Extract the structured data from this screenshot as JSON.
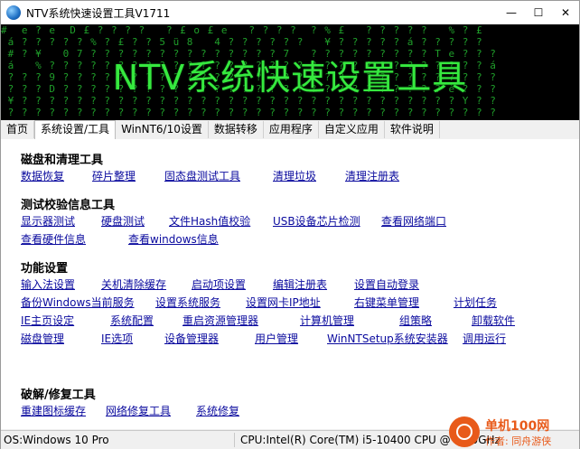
{
  "window": {
    "title": "NTV系统快速设置工具V1711",
    "controls": {
      "minimize": "—",
      "maximize": "☐",
      "close": "✕"
    }
  },
  "banner": {
    "title": "NTV系统快速设置工具",
    "matrix_color": "#1f9e2a",
    "title_color": "#36e93f"
  },
  "tabs": [
    {
      "label": "首页",
      "active": false
    },
    {
      "label": "系统设置/工具",
      "active": true
    },
    {
      "label": "WinNT6/10设置",
      "active": false
    },
    {
      "label": "数据转移",
      "active": false
    },
    {
      "label": "应用程序",
      "active": false
    },
    {
      "label": "自定义应用",
      "active": false
    },
    {
      "label": "软件说明",
      "active": false
    }
  ],
  "sections": {
    "disk": {
      "title": "磁盘和清理工具",
      "links": [
        "数据恢复",
        "碎片整理",
        "固态盘测试工具",
        "清理垃圾",
        "清理注册表"
      ]
    },
    "test": {
      "title": "测试校验信息工具",
      "row1": [
        "显示器测试",
        "硬盘测试",
        "文件Hash值校验",
        "USB设备芯片检测",
        "查看网络端口"
      ],
      "row2": [
        "查看硬件信息",
        "查看windows信息"
      ]
    },
    "function": {
      "title": "功能设置",
      "row1": [
        "输入法设置",
        "关机清除缓存",
        "启动项设置",
        "编辑注册表",
        "设置自动登录"
      ],
      "row2": [
        "备份Windows当前服务",
        "设置系统服务",
        "设置网卡IP地址",
        "右键菜单管理",
        "计划任务"
      ],
      "row3": [
        "IE主页设定",
        "系统配置",
        "重启资源管理器",
        "计算机管理",
        "组策略",
        "卸载软件"
      ],
      "row4": [
        "磁盘管理",
        "IE选项",
        "设备管理器",
        "用户管理",
        "WinNTSetup系统安装器",
        "调用运行"
      ]
    },
    "repair": {
      "title": "破解/修复工具",
      "links": [
        "重建图标缓存",
        "网络修复工具",
        "系统修复"
      ]
    }
  },
  "status": {
    "os": "OS:Windows 10 Pro",
    "cpu": "CPU:Intel(R) Core(TM) i5-10400 CPU @ 2.90GHz"
  },
  "watermark": {
    "line1": "单机100网",
    "line2": "作者: 同舟游侠"
  }
}
